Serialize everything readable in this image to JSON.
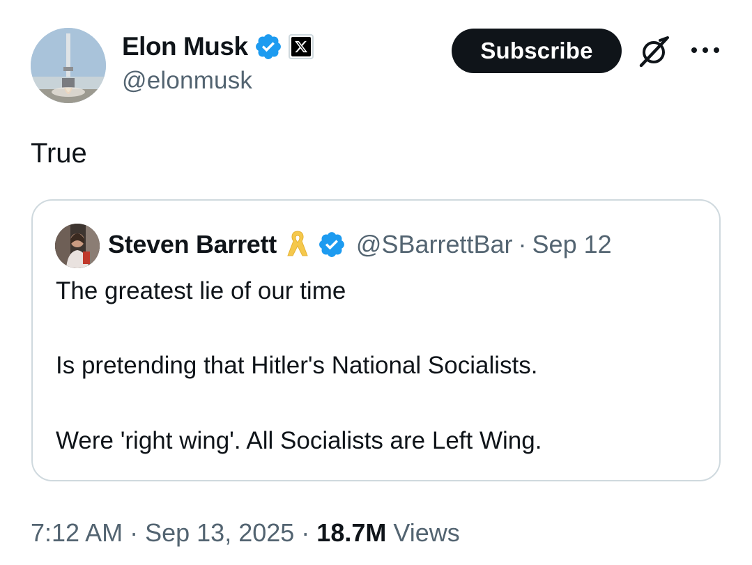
{
  "author": {
    "name": "Elon Musk",
    "handle": "@elonmusk",
    "verified": true,
    "affiliate_badge_icon": "x-logo-icon"
  },
  "actions": {
    "subscribe_label": "Subscribe",
    "grok_icon": "grok-icon",
    "more_icon": "more-icon"
  },
  "tweet": {
    "text": "True"
  },
  "quote": {
    "author_name": "Steven Barrett",
    "badge_icon": "yellow-ribbon-icon",
    "verified": true,
    "handle": "@SBarrettBar",
    "separator": "·",
    "date": "Sep 12",
    "lines": [
      "The greatest lie of our time",
      "Is pretending that Hitler's National Socialists.",
      "Were 'right wing'. All Socialists are Left Wing."
    ]
  },
  "meta": {
    "time": "7:12 AM",
    "separator": "·",
    "date": "Sep 13, 2025",
    "views_count": "18.7M",
    "views_label": "Views"
  },
  "colors": {
    "verified_blue": "#1d9bf0",
    "text_primary": "#0f1419",
    "text_secondary": "#536471",
    "border": "#cfd9de",
    "ribbon_yellow": "#f5c84c"
  }
}
